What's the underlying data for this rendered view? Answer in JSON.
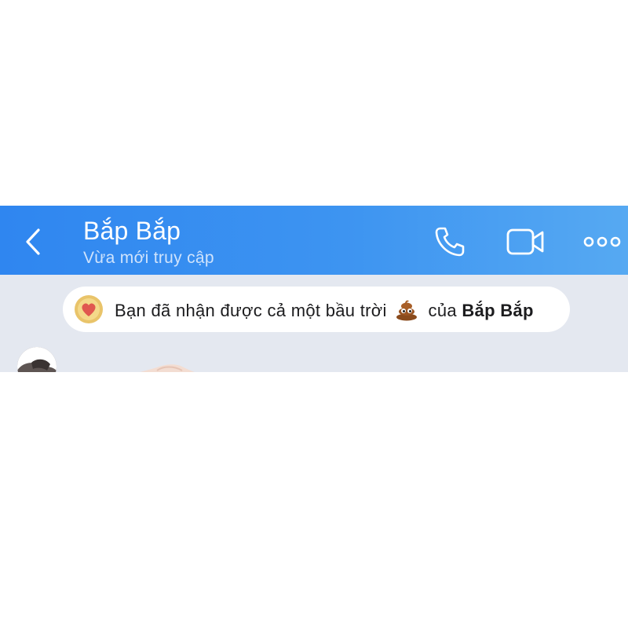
{
  "header": {
    "contact_name": "Bắp Bắp",
    "status": "Vừa mới truy cập",
    "background": "#2f86f0",
    "icons": {
      "back": "chevron-left-icon",
      "call": "phone-icon",
      "video": "video-camera-icon",
      "more": "more-dots-icon"
    }
  },
  "notice": {
    "text_before": "Bạn đã nhận được cả một bầu trời",
    "emoji": "pile-of-poo-emoji",
    "text_of": "của",
    "name": "Bắp Bắp",
    "badge_icon": "heart-badge-icon"
  },
  "chat": {
    "background": "#e4e8f0"
  }
}
